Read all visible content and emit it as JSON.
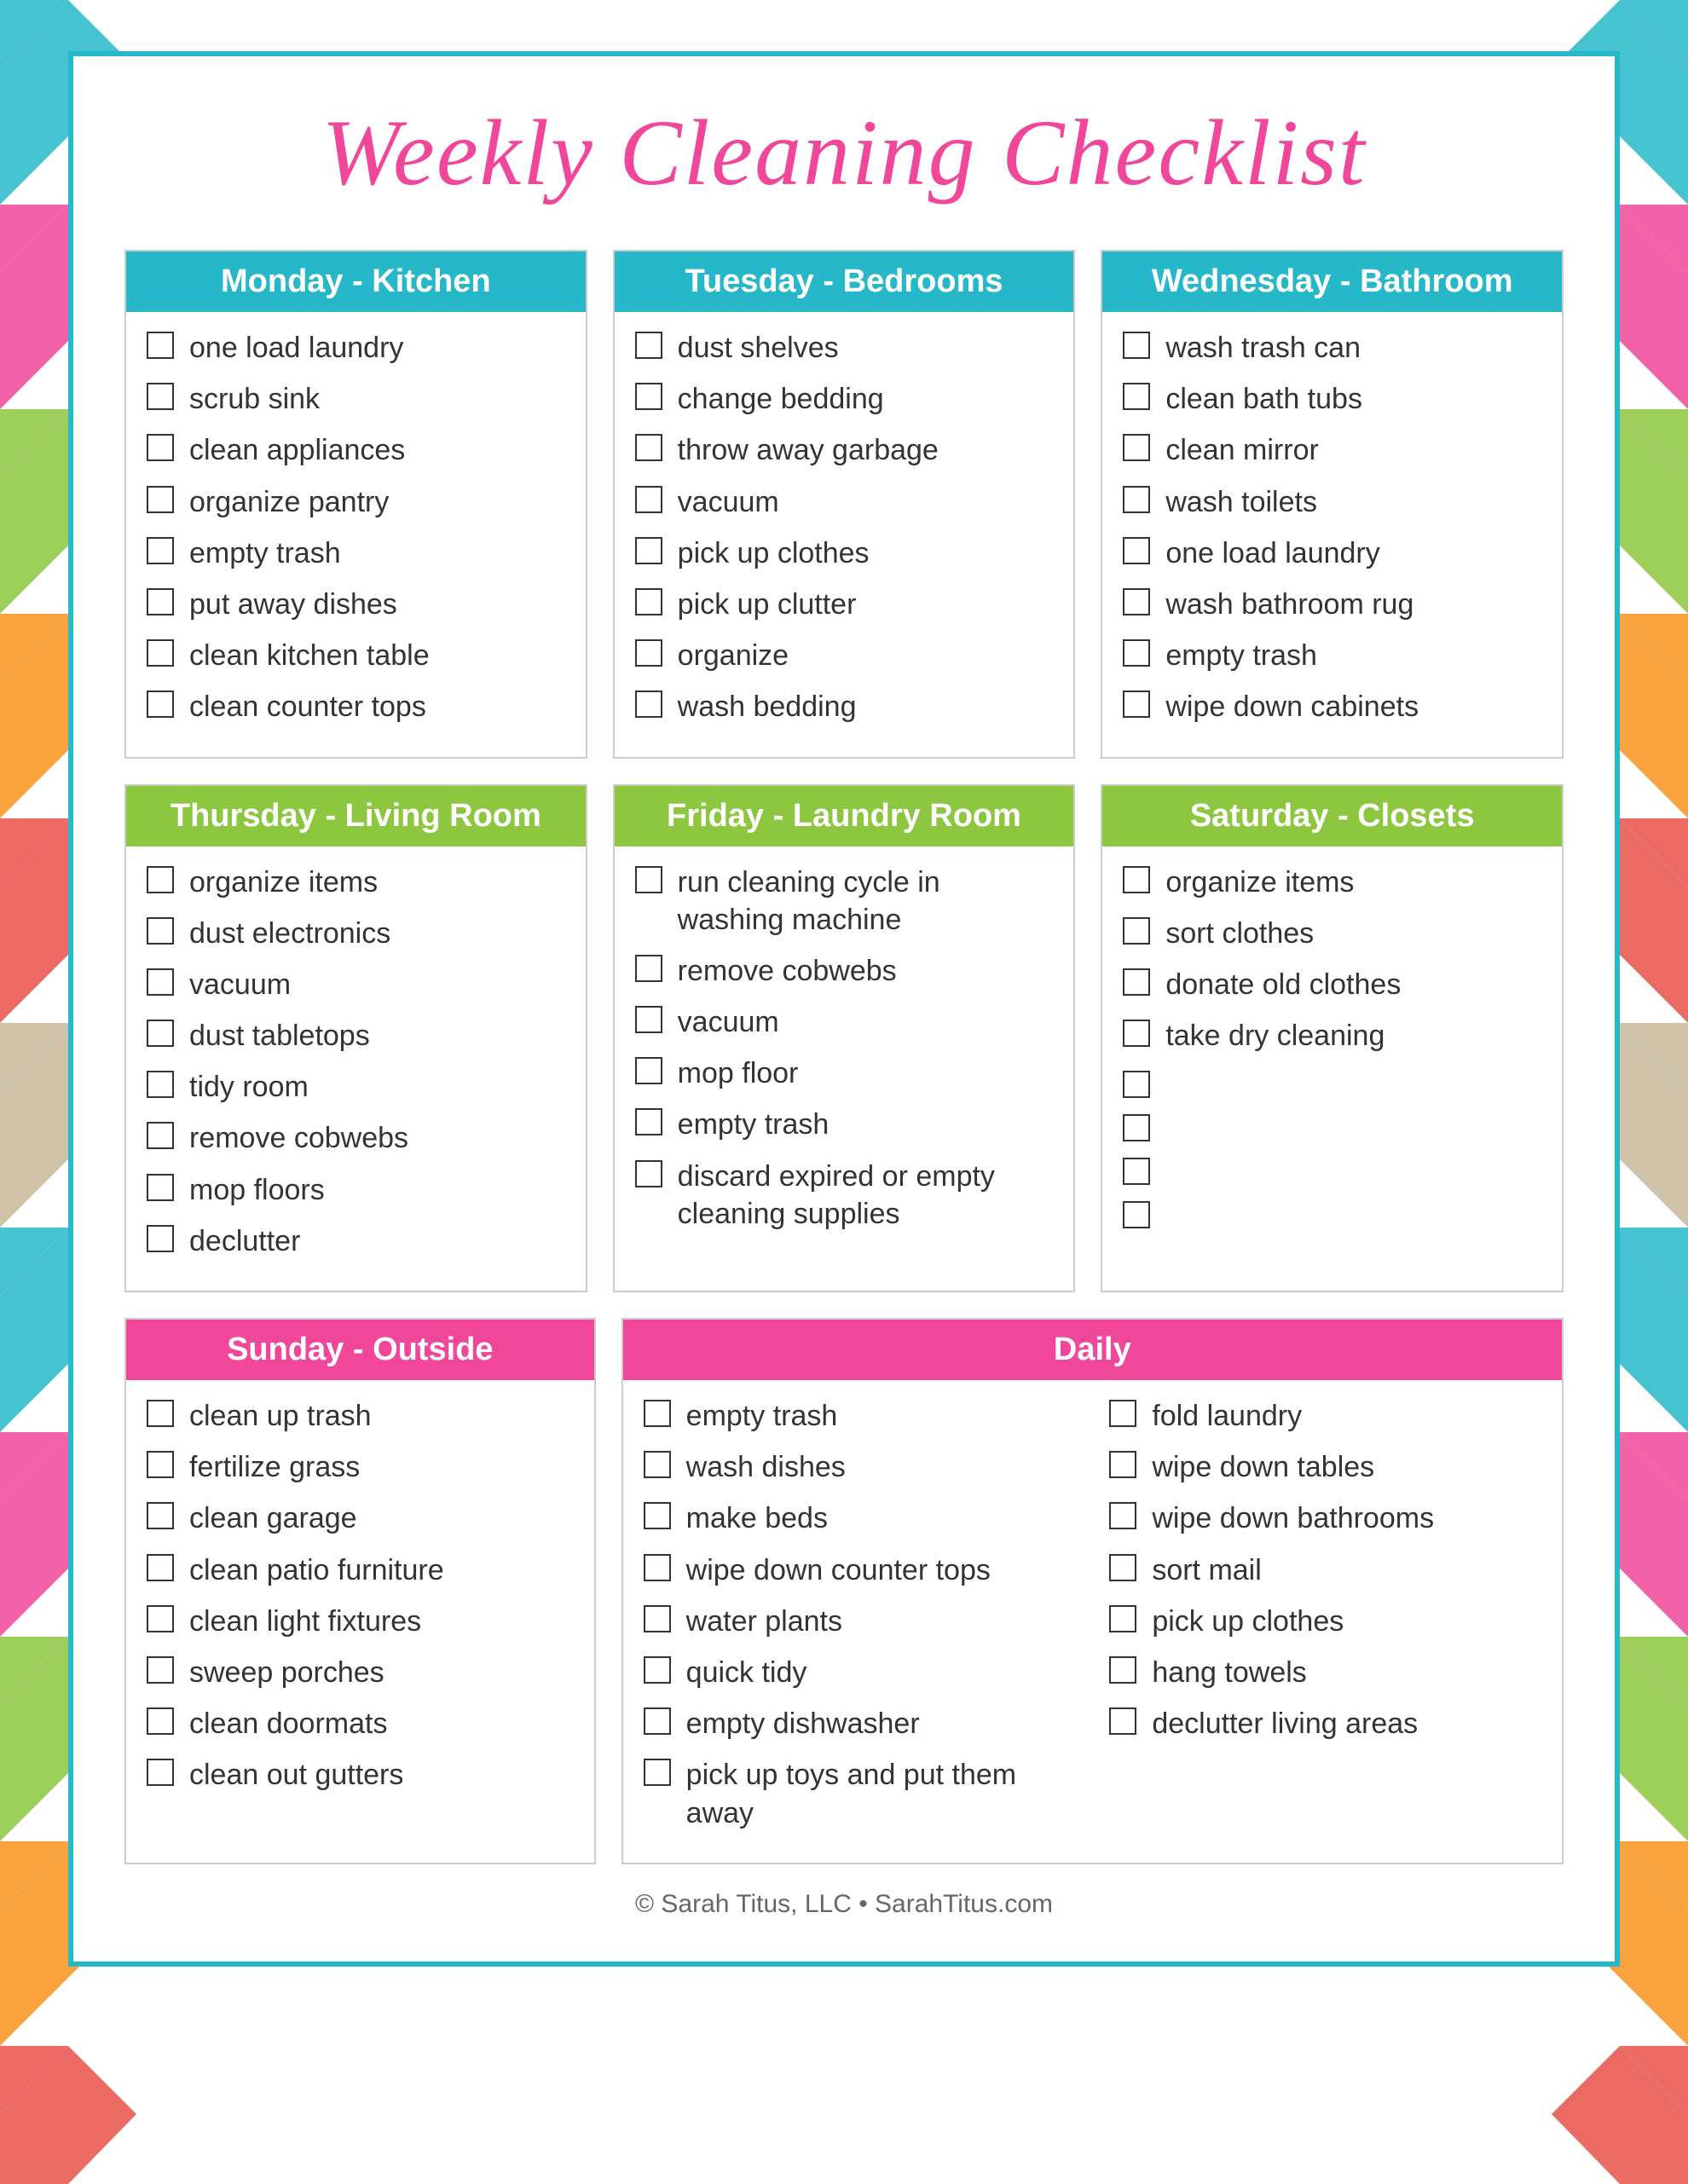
{
  "title": "Weekly Cleaning Checklist",
  "footer": "© Sarah Titus, LLC • SarahTitus.com",
  "sections": {
    "monday": {
      "header": "Monday - Kitchen",
      "header_color": "teal",
      "items": [
        "one load laundry",
        "scrub sink",
        "clean appliances",
        "organize pantry",
        "empty trash",
        "put away dishes",
        "clean kitchen table",
        "clean counter tops"
      ]
    },
    "tuesday": {
      "header": "Tuesday - Bedrooms",
      "header_color": "teal",
      "items": [
        "dust shelves",
        "change bedding",
        "throw away garbage",
        "vacuum",
        "pick up clothes",
        "pick up clutter",
        "organize",
        "wash bedding"
      ]
    },
    "wednesday": {
      "header": "Wednesday - Bathroom",
      "header_color": "teal",
      "items": [
        "wash trash can",
        "clean bath tubs",
        "clean mirror",
        "wash toilets",
        "one load laundry",
        "wash bathroom rug",
        "empty trash",
        "wipe down cabinets"
      ]
    },
    "thursday": {
      "header": "Thursday - Living Room",
      "header_color": "green",
      "items": [
        "organize items",
        "dust electronics",
        "vacuum",
        "dust tabletops",
        "tidy room",
        "remove cobwebs",
        "mop floors",
        "declutter"
      ]
    },
    "friday": {
      "header": "Friday - Laundry Room",
      "header_color": "green",
      "items": [
        "run cleaning cycle in washing machine",
        "remove cobwebs",
        "vacuum",
        "mop floor",
        "empty trash",
        "discard expired or empty cleaning supplies"
      ]
    },
    "saturday": {
      "header": "Saturday - Closets",
      "header_color": "green",
      "items": [
        "organize items",
        "sort clothes",
        "donate old clothes",
        "take dry cleaning",
        "",
        "",
        "",
        ""
      ]
    },
    "sunday": {
      "header": "Sunday - Outside",
      "header_color": "pink",
      "items": [
        "clean up trash",
        "fertilize grass",
        "clean garage",
        "clean patio furniture",
        "clean light fixtures",
        "sweep porches",
        "clean doormats",
        "clean out gutters"
      ]
    },
    "daily": {
      "header": "Daily",
      "header_color": "pink",
      "items_col1": [
        "empty trash",
        "wash dishes",
        "make beds",
        "wipe down counter tops",
        "water plants",
        "quick tidy",
        "empty dishwasher",
        "pick up toys and put them away"
      ],
      "items_col2": [
        "fold laundry",
        "wipe down tables",
        "wipe down bathrooms",
        "sort mail",
        "pick up clothes",
        "hang towels",
        "declutter living areas"
      ]
    }
  },
  "chevron_colors": [
    "#26b8c8",
    "#f0479a",
    "#8dc63f",
    "#f7941d",
    "#e8524a",
    "#c0b9a8",
    "#f0479a"
  ]
}
